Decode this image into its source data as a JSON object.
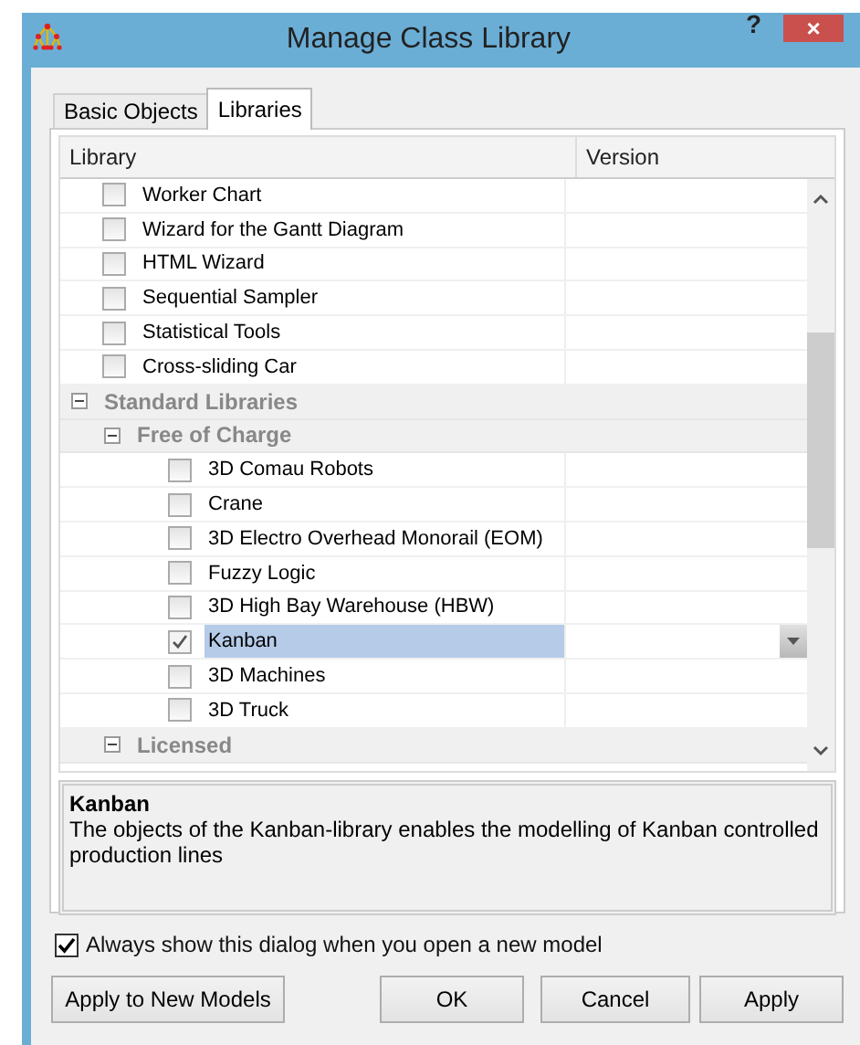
{
  "window": {
    "title": "Manage Class Library",
    "help": "?",
    "close": "×"
  },
  "tabs": [
    {
      "label": "Basic Objects",
      "selected": false
    },
    {
      "label": "Libraries",
      "selected": true
    }
  ],
  "table": {
    "columns": [
      "Library",
      "Version"
    ],
    "tree": [
      {
        "kind": "item",
        "label": "Worker Chart",
        "checked": false,
        "selected": false
      },
      {
        "kind": "item",
        "label": "Wizard for the Gantt Diagram",
        "checked": false,
        "selected": false
      },
      {
        "kind": "item",
        "label": "HTML Wizard",
        "checked": false,
        "selected": false
      },
      {
        "kind": "item",
        "label": "Sequential Sampler",
        "checked": false,
        "selected": false
      },
      {
        "kind": "item",
        "label": "Statistical Tools",
        "checked": false,
        "selected": false
      },
      {
        "kind": "item",
        "label": "Cross-sliding Car",
        "checked": false,
        "selected": false
      },
      {
        "kind": "group",
        "label": "Standard Libraries",
        "expanded": true,
        "children": [
          {
            "kind": "group",
            "label": "Free of Charge",
            "expanded": true,
            "children": [
              {
                "kind": "item",
                "label": "3D Comau Robots",
                "checked": false,
                "selected": false
              },
              {
                "kind": "item",
                "label": "Crane",
                "checked": false,
                "selected": false
              },
              {
                "kind": "item",
                "label": "3D Electro Overhead Monorail (EOM)",
                "checked": false,
                "selected": false
              },
              {
                "kind": "item",
                "label": "Fuzzy Logic",
                "checked": false,
                "selected": false
              },
              {
                "kind": "item",
                "label": "3D High Bay Warehouse (HBW)",
                "checked": false,
                "selected": false
              },
              {
                "kind": "item",
                "label": "Kanban",
                "checked": true,
                "selected": true
              },
              {
                "kind": "item",
                "label": "3D Machines",
                "checked": false,
                "selected": false
              },
              {
                "kind": "item",
                "label": "3D Truck",
                "checked": false,
                "selected": false
              }
            ]
          },
          {
            "kind": "group",
            "label": "Licensed",
            "expanded": true
          }
        ]
      }
    ]
  },
  "description": {
    "title": "Kanban",
    "text": "The objects of the Kanban-library enables the modelling of Kanban controlled production lines"
  },
  "always_show": {
    "label": "Always show this dialog when you open a new model",
    "checked": true
  },
  "buttons": [
    "Apply to New Models",
    "OK",
    "Cancel",
    "Apply"
  ]
}
